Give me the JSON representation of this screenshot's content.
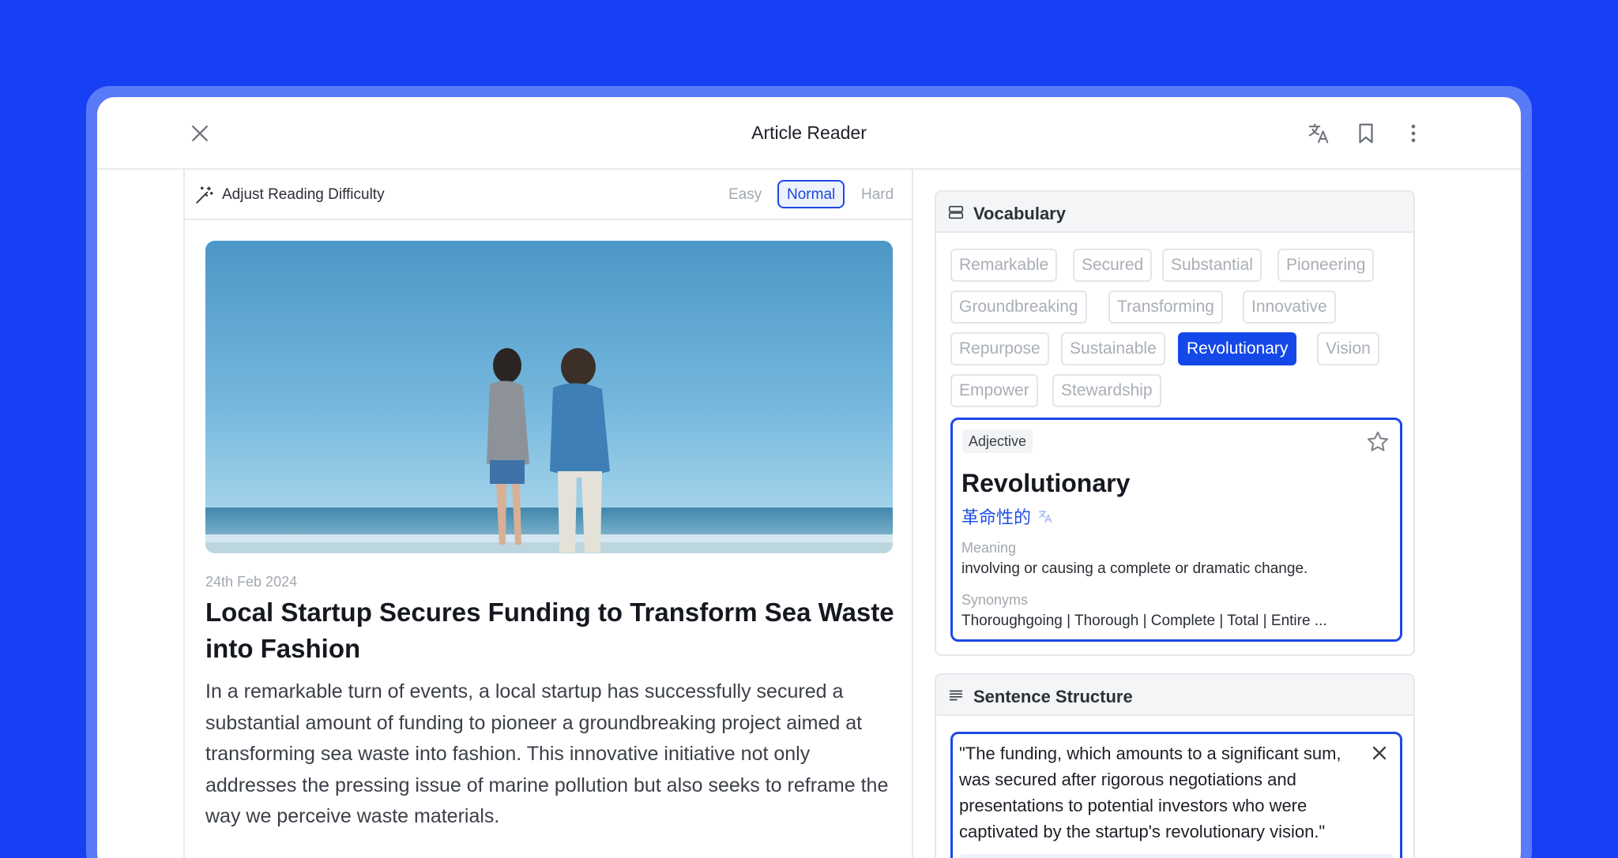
{
  "window": {
    "title": "Article Reader"
  },
  "colors": {
    "background": "#1740f5",
    "accent": "#1448e8",
    "translation": "#1f4ee8"
  },
  "toolbar": {
    "close_icon": "close-icon",
    "translate_icon": "translate-icon",
    "bookmark_icon": "bookmark-icon",
    "more_icon": "more-vertical-icon"
  },
  "difficulty": {
    "label": "Adjust Reading Difficulty",
    "options": [
      "Easy",
      "Normal",
      "Hard"
    ],
    "selected": "Normal"
  },
  "article": {
    "date": "24th Feb 2024",
    "title": "Local Startup Secures Funding to Transform Sea Waste into Fashion",
    "body": "In a remarkable turn of events, a local startup has successfully secured a substantial amount of funding to pioneer a groundbreaking project aimed at transforming sea waste into fashion. This innovative initiative not only addresses the pressing issue of marine pollution but also seeks to reframe the way we perceive waste materials."
  },
  "vocabulary": {
    "title": "Vocabulary",
    "words": [
      "Remarkable",
      "Secured",
      "Substantial",
      "Pioneering",
      "Groundbreaking",
      "Transforming",
      "Innovative",
      "Repurpose",
      "Sustainable",
      "Revolutionary",
      "Vision",
      "Empower",
      "Stewardship"
    ],
    "selected": "Revolutionary",
    "definition": {
      "part_of_speech": "Adjective",
      "word": "Revolutionary",
      "translation": "革命性的",
      "meaning_label": "Meaning",
      "meaning": "involving or causing a complete or dramatic change.",
      "synonyms_label": "Synonyms",
      "synonyms": "Thoroughgoing | Thorough | Complete | Total | Entire ..."
    }
  },
  "sentence_structure": {
    "title": "Sentence Structure",
    "sentence": "\"The funding, which amounts to a significant sum, was secured after rigorous negotiations and presentations to potential investors who were captivated by the startup's revolutionary vision.\""
  }
}
